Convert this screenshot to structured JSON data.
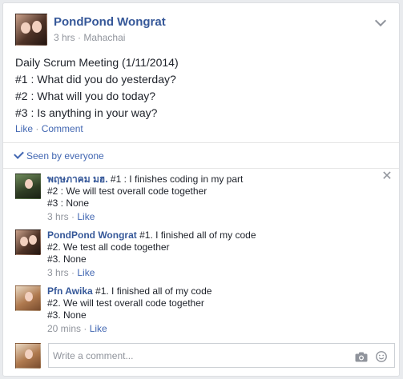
{
  "post": {
    "author": "PondPond Wongrat",
    "time": "3 hrs",
    "separator": "·",
    "location": "Mahachai",
    "lines": [
      "Daily Scrum Meeting (1/11/2014)",
      "#1 : What did you do yesterday?",
      "#2 : What will you do today?",
      "#3 : Is anything in your way?"
    ],
    "like_label": "Like",
    "comment_label": "Comment",
    "seen_label": "Seen by everyone"
  },
  "comments": [
    {
      "author": "พฤษภาคม มฮ.",
      "first_line": "#1 : I finishes coding in my part",
      "line2": "#2 : We will test overall code together",
      "line3": "#3 : None",
      "time": "3 hrs",
      "like_label": "Like"
    },
    {
      "author": "PondPond Wongrat",
      "first_line": "#1. I finished all of my code",
      "line2": "#2. We test all code together",
      "line3": "#3. None",
      "time": "3 hrs",
      "like_label": "Like"
    },
    {
      "author": "Pfn Awika",
      "first_line": "#1. I finished all of my code",
      "line2": "#2. We will test overall code together",
      "line3": "#3. None",
      "time": "20 mins",
      "like_label": "Like"
    }
  ],
  "composer": {
    "placeholder": "Write a comment..."
  },
  "icons": {
    "options": "chevron-down-icon",
    "seen": "check-icon",
    "close": "close-icon",
    "camera": "camera-icon",
    "sticker": "smiley-icon"
  },
  "colors": {
    "link": "#4267b2",
    "name": "#365899",
    "muted": "#90949c"
  }
}
